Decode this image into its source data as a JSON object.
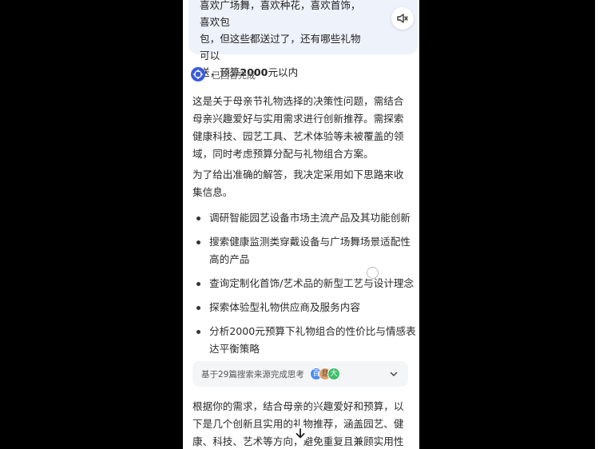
{
  "user_message": {
    "line1": "喜欢广场舞，喜欢种花，喜欢首饰，喜欢包",
    "line2": "包，但这些都送过了，还有哪些礼物可以",
    "line3_prefix": "送，预算",
    "line3_bold": "2000",
    "line3_suffix": "元以内"
  },
  "mute_icon": "speaker-mute-icon",
  "status": {
    "icon": "ai-logo-icon",
    "label": "已回答完成"
  },
  "thinking": {
    "paragraph1": "这是关于母亲节礼物选择的决策性问题，需结合母亲兴趣爱好与实用需求进行创新推荐。需探索健康科技、园艺工具、艺术体验等未被覆盖的领域，同时考虑预算分配与礼物组合方案。",
    "paragraph2": "为了给出准确的解答，我决定采用如下思路来收集信息。",
    "steps": [
      "调研智能园艺设备市场主流产品及其功能创新",
      "搜索健康监测类穿戴设备与广场舞场景适配性高的产品",
      "查询定制化首饰/艺术品的新型工艺与设计理念",
      "探索体验型礼物供应商及服务内容",
      "分析2000元预算下礼物组合的性价比与情感表达平衡策略"
    ]
  },
  "sources": {
    "label": "基于29篇搜索来源完成思考",
    "avatars": [
      "百",
      "旦",
      "大"
    ],
    "expand_icon": "chevron-down-icon"
  },
  "answer": {
    "text": "根据你的需求，结合母亲的兴趣爱好和预算，以下是几个创新且实用的礼物推荐，涵盖园艺、健康、科技、艺术等方向，避免重复且兼顾实用性与惊喜"
  },
  "scroll_down_icon": "arrow-down-icon",
  "colors": {
    "accent": "#3b5bdb",
    "bubble": "#eef2fb",
    "sources_bg": "#f4f5f7"
  }
}
